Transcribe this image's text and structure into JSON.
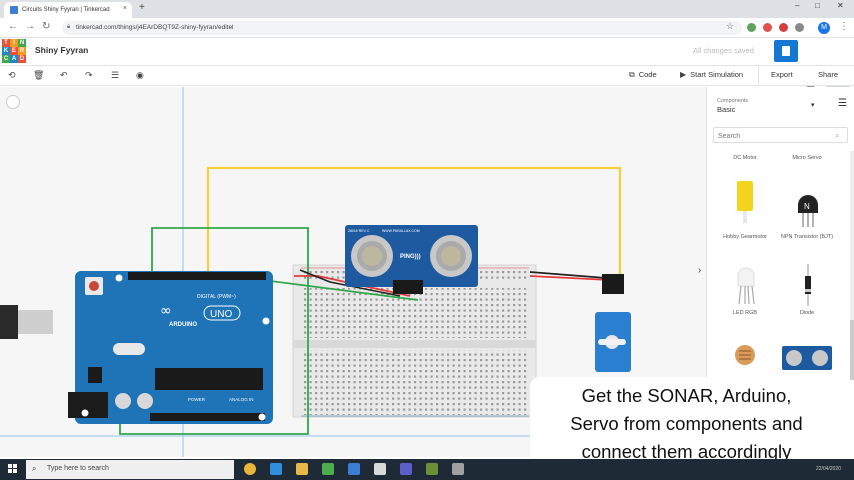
{
  "browser": {
    "tab_title": "Circuits Shiny Fyyran | Tinkercad",
    "tab_close": "×",
    "new_tab": "+",
    "url": "tinkercad.com/things/j4EArDBQT9Z-shiny-fyyran/editel",
    "window_min": "–",
    "window_max": "□",
    "window_close": "✕",
    "avatar_letter": "M"
  },
  "app": {
    "logo_letters": [
      "TIN",
      "KER",
      "CAD"
    ],
    "project_name": "Shiny Fyyran",
    "save_status": "All changes saved"
  },
  "toolbar": {
    "code_label": "Code",
    "start_sim_label": "Start Simulation",
    "export_label": "Export",
    "share_label": "Share"
  },
  "panel": {
    "components_label": "Components",
    "components_value": "Basic",
    "search_placeholder": "Search",
    "items": [
      {
        "label": "DC Motor"
      },
      {
        "label": "Micro Servo"
      },
      {
        "label": "Hobby Gearmotor"
      },
      {
        "label": "NPN Transistor (BJT)"
      },
      {
        "label": "LED RGB"
      },
      {
        "label": "Diode"
      },
      {
        "label": ""
      },
      {
        "label": ""
      }
    ]
  },
  "board": {
    "arduino_brand": "ARDUINO",
    "arduino_model": "UNO",
    "digital_label": "DIGITAL (PWM~)",
    "power_label": "POWER",
    "analog_label": "ANALOG IN",
    "sensor_brand": "WWW.PARALLAX.COM",
    "sensor_model": "28015 REV C",
    "sensor_name": "PING)))"
  },
  "caption": {
    "line1": "Get the SONAR, Arduino,",
    "line2": "Servo from components and",
    "line3": "connect them accordingly"
  },
  "taskbar": {
    "search_placeholder": "Type here to search",
    "clock": "22/04/2020"
  },
  "colors": {
    "accent": "#1477d4",
    "arduino": "#1f73b7",
    "sensor": "#1d5aa0",
    "wire_yellow": "#f4d13a",
    "wire_green": "#2fa84a",
    "wire_red": "#e23a3a",
    "wire_black": "#222222",
    "servo": "#2a7fd0",
    "taskbar": "#1e2a36"
  }
}
